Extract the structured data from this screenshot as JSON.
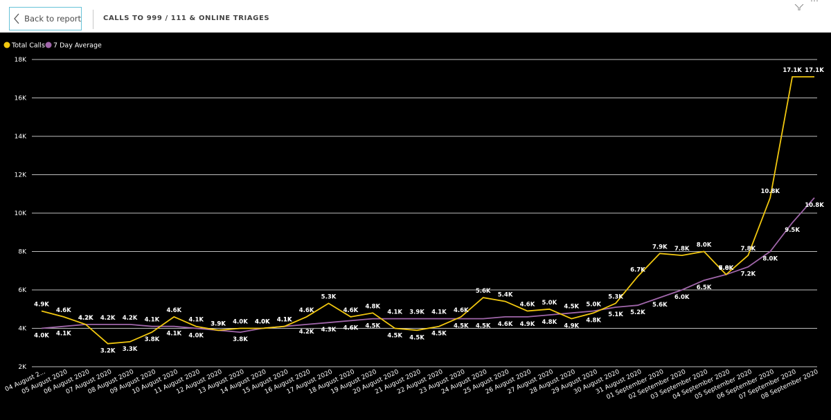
{
  "header": {
    "back_label": "Back to report",
    "title": "CALLS TO 999 / 111 & ONLINE TRIAGES"
  },
  "icons": {
    "back": "chevron-left-icon",
    "filter": "filter-icon",
    "more": "more-options-icon"
  },
  "colors": {
    "total_calls": "#f2c80f",
    "seven_day_avg": "#a066aa",
    "background": "#000000",
    "grid": "#ffffff"
  },
  "chart_data": {
    "type": "line",
    "legend_position": "top-left",
    "grid": true,
    "ylim": [
      2000,
      18000
    ],
    "yticks": [
      {
        "value": 2000,
        "label": "2K"
      },
      {
        "value": 4000,
        "label": "4K"
      },
      {
        "value": 6000,
        "label": "6K"
      },
      {
        "value": 8000,
        "label": "8K"
      },
      {
        "value": 10000,
        "label": "10K"
      },
      {
        "value": 12000,
        "label": "12K"
      },
      {
        "value": 14000,
        "label": "14K"
      },
      {
        "value": 16000,
        "label": "16K"
      },
      {
        "value": 18000,
        "label": "18K"
      }
    ],
    "categories": [
      "04 August 2...",
      "05 August 2020",
      "06 August 2020",
      "07 August 2020",
      "08 August 2020",
      "09 August 2020",
      "10 August 2020",
      "11 August 2020",
      "12 August 2020",
      "13 August 2020",
      "14 August 2020",
      "15 August 2020",
      "16 August 2020",
      "17 August 2020",
      "18 August 2020",
      "19 August 2020",
      "20 August 2020",
      "21 August 2020",
      "22 August 2020",
      "23 August 2020",
      "24 August 2020",
      "25 August 2020",
      "26 August 2020",
      "27 August 2020",
      "28 August 2020",
      "29 August 2020",
      "30 August 2020",
      "31 August 2020",
      "01 September 2020",
      "02 September 2020",
      "03 September 2020",
      "04 September 2020",
      "05 September 2020",
      "06 September 2020",
      "07 September 2020",
      "08 September 2020"
    ],
    "series": [
      {
        "name": "Total Calls",
        "color": "#f2c80f",
        "values": [
          4900,
          4600,
          4200,
          3200,
          3300,
          3800,
          4600,
          4100,
          3900,
          4000,
          4000,
          4100,
          4600,
          5300,
          4600,
          4800,
          4000,
          3900,
          4100,
          4600,
          5600,
          5400,
          4900,
          5000,
          4500,
          4800,
          5300,
          6700,
          7900,
          7800,
          8000,
          6800,
          7800,
          10800,
          17100,
          17100
        ],
        "labels": [
          "4.9K",
          "4.6K",
          "4.2K",
          "3.2K",
          "3.3K",
          "3.8K",
          "4.6K",
          "4.1K",
          "3.9K",
          "4.0K",
          "4.0K",
          "4.1K",
          "4.6K",
          "5.3K",
          "4.6K",
          "4.8K",
          "4.5K",
          "4.5K",
          "4.5K",
          "4.6K",
          "5.6K",
          "5.4K",
          "4.6K",
          "5.0K",
          "4.9K",
          "4.8K",
          "5.3K",
          "6.7K",
          "7.9K",
          "7.8K",
          "8.0K",
          "6.8K",
          "7.8K",
          "10.8K",
          "17.1K",
          "17.1K"
        ]
      },
      {
        "name": "7 Day Average",
        "color": "#a066aa",
        "values": [
          4000,
          4100,
          4200,
          4200,
          4200,
          4100,
          4100,
          4000,
          3900,
          3800,
          4000,
          4100,
          4200,
          4300,
          4400,
          4500,
          4500,
          4500,
          4500,
          4500,
          4500,
          4600,
          4600,
          4700,
          4800,
          4900,
          5100,
          5200,
          5600,
          6000,
          6500,
          6800,
          7200,
          8000,
          9500,
          10800
        ],
        "labels": [
          "4.0K",
          "4.1K",
          "4.2K",
          "4.2K",
          "4.2K",
          "4.1K",
          "4.1K",
          "4.0K",
          "3.9K",
          "3.8K",
          "4.0K",
          "4.1K",
          "4.2K",
          "4.3K",
          "4.6K",
          "4.5K",
          "4.1K",
          "3.9K",
          "4.1K",
          "4.5K",
          "4.5K",
          "4.6K",
          "4.9K",
          "4.8K",
          "4.5K",
          "5.0K",
          "5.1K",
          "5.2K",
          "5.6K",
          "6.0K",
          "6.5K",
          "7.0K",
          "7.2K",
          "8.0K",
          "9.5K",
          "10.8K"
        ]
      }
    ]
  }
}
